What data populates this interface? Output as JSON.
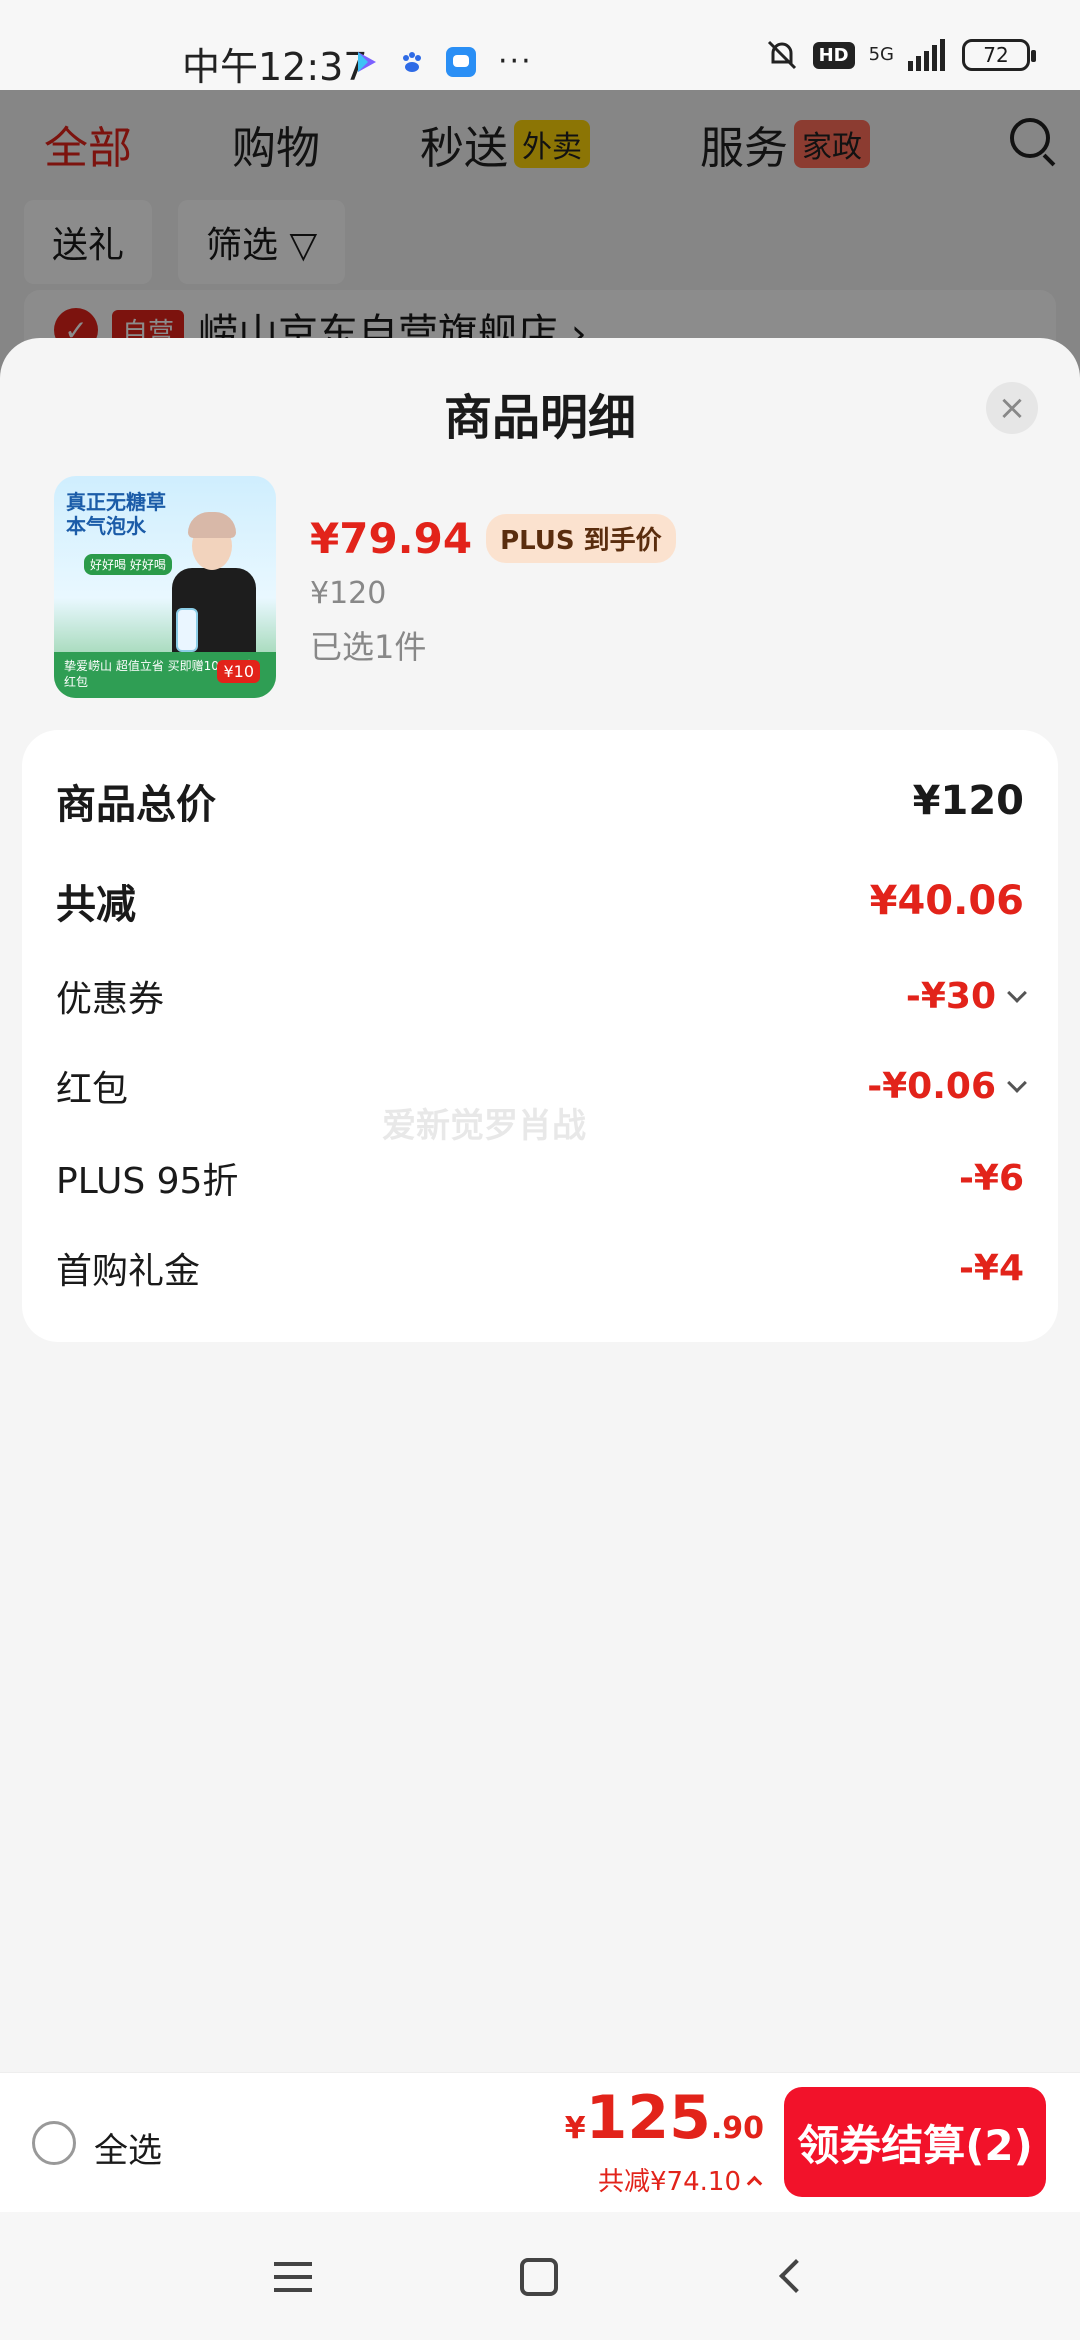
{
  "status_bar": {
    "time": "中午12:37",
    "hd": "HD",
    "network": "5G",
    "battery": "72"
  },
  "background": {
    "tabs": [
      {
        "label": "全部"
      },
      {
        "label": "购物"
      },
      {
        "label": "秒送",
        "badge": "外卖"
      },
      {
        "label": "服务",
        "badge": "家政"
      }
    ],
    "chips": [
      "送礼",
      "筛选 ▽"
    ],
    "store_tag": "自营",
    "store_name": "崂山京东自营旗舰店 ›"
  },
  "sheet": {
    "title": "商品明细",
    "product": {
      "image_text": {
        "headline": "真正无糖草本气泡水",
        "tag": "好好喝 好好喝",
        "footer": "挚爱崂山 超值立省 买即赠10元现金红包",
        "red_badge": "¥10"
      },
      "price": "¥79.94",
      "plus_badge": "PLUS 到手价",
      "original_price": "¥120",
      "selected_qty": "已选1件"
    },
    "details": {
      "total_label": "商品总价",
      "total_value": "¥120",
      "reduced_label": "共减",
      "reduced_value": "¥40.06",
      "items": [
        {
          "label": "优惠券",
          "value": "-¥30",
          "expandable": true
        },
        {
          "label": "红包",
          "value": "-¥0.06",
          "expandable": true
        },
        {
          "label": "PLUS 95折",
          "value": "-¥6",
          "expandable": false
        },
        {
          "label": "首购礼金",
          "value": "-¥4",
          "expandable": false
        }
      ],
      "watermark": "爱新觉罗肖战"
    }
  },
  "bottom_bar": {
    "select_all": "全选",
    "currency": "¥",
    "total_int": "125",
    "total_dec": ".90",
    "reduced_total": "共减¥74.10",
    "checkout": "领券结算(2)"
  },
  "colors": {
    "accent": "#e2231a",
    "checkout": "#f2122a",
    "plus_badge_bg": "#fbe2cf"
  }
}
